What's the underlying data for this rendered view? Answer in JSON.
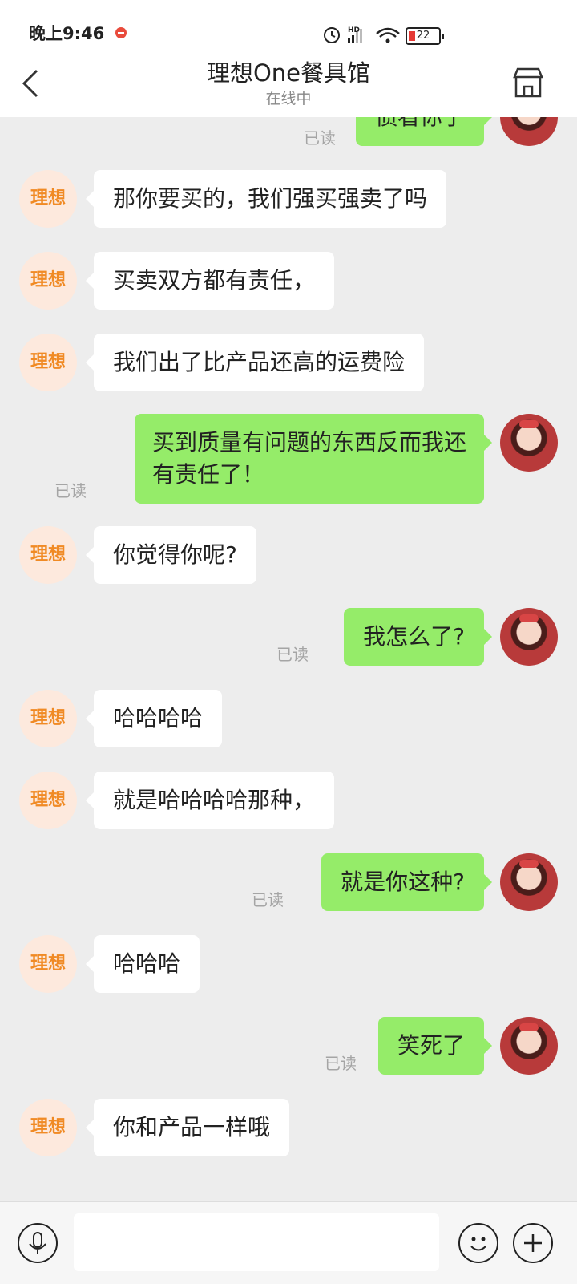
{
  "status_bar": {
    "time": "晚上9:46",
    "battery": "22"
  },
  "header": {
    "title": "理想One餐具馆",
    "subtitle": "在线中"
  },
  "shop_avatar_text": "理想",
  "messages": [
    {
      "side": "right",
      "text": "偾看你了",
      "read": "已读"
    },
    {
      "side": "left",
      "text": "那你要买的，我们强买强卖了吗"
    },
    {
      "side": "left",
      "text": "买卖双方都有责任，"
    },
    {
      "side": "left",
      "text": "我们出了比产品还高的运费险"
    },
    {
      "side": "right",
      "text": "买到质量有问题的东西反而我还\n有责任了！",
      "read": "已读"
    },
    {
      "side": "left",
      "text": "你觉得你呢?"
    },
    {
      "side": "right",
      "text": "我怎么了?",
      "read": "已读"
    },
    {
      "side": "left",
      "text": "哈哈哈哈"
    },
    {
      "side": "left",
      "text": "就是哈哈哈哈那种，"
    },
    {
      "side": "right",
      "text": "就是你这种?",
      "read": "已读"
    },
    {
      "side": "left",
      "text": "哈哈哈"
    },
    {
      "side": "right",
      "text": "笑死了",
      "read": "已读"
    },
    {
      "side": "left",
      "text": "你和产品一样哦"
    }
  ],
  "icons": {
    "back": "back-arrow-icon",
    "shop": "shop-icon",
    "voice": "microphone-icon",
    "emoji": "emoji-icon",
    "more": "plus-icon"
  },
  "colors": {
    "my_bubble": "#95ec69",
    "their_bubble": "#ffffff",
    "shop_avatar_text": "#f08a24"
  }
}
